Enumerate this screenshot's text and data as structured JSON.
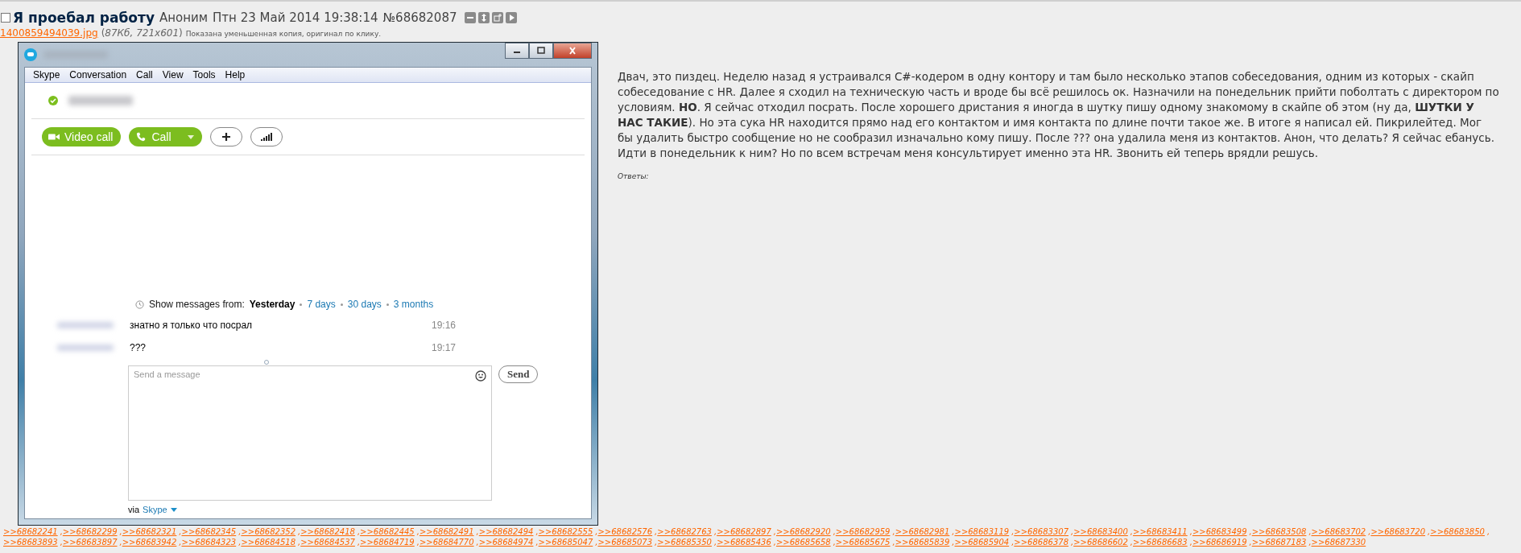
{
  "post": {
    "checked": false,
    "subject": "Я проебал работу",
    "author": "Аноним",
    "date": "Птн 23 Май 2014 19:38:14",
    "number": "№68682087",
    "file": {
      "name": "1400859494039.jpg",
      "info": "(*87Кб, 721x601*)",
      "note": "Показана уменьшенная копия, оригинал по клику."
    },
    "image": {
      "menu": [
        "Skype",
        "Conversation",
        "Call",
        "View",
        "Tools",
        "Help"
      ],
      "buttons": [
        {
          "kind": "video",
          "label": "Video call"
        },
        {
          "kind": "call",
          "label": "Call"
        },
        {
          "kind": "add"
        },
        {
          "kind": "signal"
        }
      ],
      "history_label": "Show messages from:",
      "history_options": [
        {
          "label": "Yesterday",
          "selected": true
        },
        {
          "label": "7 days",
          "selected": false
        },
        {
          "label": "30 days",
          "selected": false
        },
        {
          "label": "3 months",
          "selected": false
        }
      ],
      "messages": [
        {
          "text": "знатно я только что посрал",
          "time": "19:16"
        },
        {
          "text": "???",
          "time": "19:17"
        }
      ],
      "input": {
        "placeholder": "Send a message"
      },
      "send": "Send",
      "via": "via",
      "via_link": "Skype"
    },
    "body": "Двач, это пиздец. Неделю назад я устраивался C#-кодером в одну контору и там было несколько этапов собеседования, одним из которых - скайп собеседование с HR. Далее я сходил на техническую часть и вроде бы всё решилось ок. Назначили на понедельник прийти поболтать с директором по условиям. **НО**. Я сейчас отходил посрать. После хорошего дристания я иногда в шутку пишу одному знакомому в скайпе об этом (ну да, **ШУТКИ У НАС ТАКИЕ**). Но эта сука HR находится прямо над его контактом и имя контакта по длине почти такое же. В итоге я написал ей. Пикрилейтед. Мог бы удалить быстро сообщение но не сообразил изначально кому пишу. После ??? она удалила меня из контактов. Анон, что делать? Я сейчас ебанусь. Идти в понедельник к ним? Но по всем встречам меня консультирует именно эта HR. Звонить ей теперь врядли решусь.",
    "replies_label": "Ответы:",
    "reply_separator": ",",
    "replies": [
      ">>68682241",
      ">>68682299",
      ">>68682321",
      ">>68682345",
      ">>68682352",
      ">>68682418",
      ">>68682445",
      ">>68682491",
      ">>68682494",
      ">>68682555",
      ">>68682576",
      ">>68682763",
      ">>68682897",
      ">>68682920",
      ">>68682959",
      ">>68682981",
      ">>68683119",
      ">>68683307",
      ">>68683400",
      ">>68683411",
      ">>68683499",
      ">>68683508",
      ">>68683702",
      ">>68683720",
      ">>68683850",
      ">>68683893",
      ">>68683897",
      ">>68683942",
      ">>68684323",
      ">>68684518",
      ">>68684537",
      ">>68684719",
      ">>68684770",
      ">>68684974",
      ">>68685047",
      ">>68685073",
      ">>68685350",
      ">>68685436",
      ">>68685658",
      ">>68685675",
      ">>68685839",
      ">>68685904",
      ">>68686378",
      ">>68686602",
      ">>68686683",
      ">>68686919",
      ">>68687183",
      ">>68687330"
    ]
  }
}
